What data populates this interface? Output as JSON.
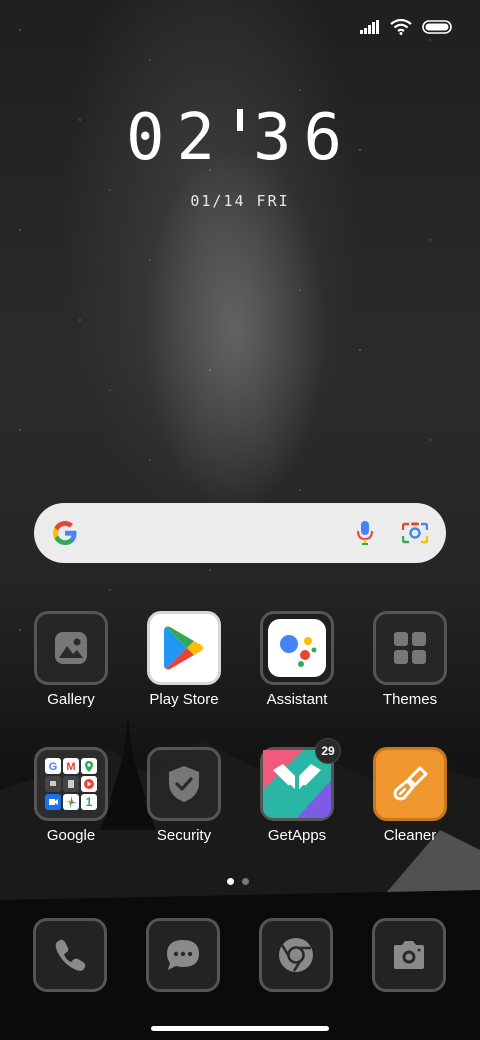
{
  "status_bar": {
    "signal_icon": "signal-bars-icon",
    "wifi_icon": "wifi-icon",
    "battery_icon": "battery-icon"
  },
  "clock": {
    "hours": "02",
    "minutes": "36"
  },
  "date": "01/14 FRI",
  "search_bar": {
    "logo_icon": "google-g-icon",
    "mic_icon": "microphone-icon",
    "lens_icon": "lens-camera-icon"
  },
  "apps": [
    {
      "label": "Gallery",
      "icon": "gallery-icon"
    },
    {
      "label": "Play Store",
      "icon": "play-store-icon"
    },
    {
      "label": "Assistant",
      "icon": "assistant-icon"
    },
    {
      "label": "Themes",
      "icon": "themes-icon"
    },
    {
      "label": "Google",
      "icon": "google-folder-icon"
    },
    {
      "label": "Security",
      "icon": "shield-check-icon"
    },
    {
      "label": "GetApps",
      "icon": "getapps-icon",
      "badge": "29"
    },
    {
      "label": "Cleaner",
      "icon": "broom-icon"
    }
  ],
  "page_indicator": {
    "pages": 2,
    "active": 1
  },
  "dock": [
    {
      "icon": "phone-icon"
    },
    {
      "icon": "messages-icon"
    },
    {
      "icon": "chrome-icon"
    },
    {
      "icon": "camera-icon"
    }
  ],
  "colors": {
    "google_blue": "#4285F4",
    "google_red": "#EA4335",
    "google_yellow": "#FBBC05",
    "google_green": "#34A853",
    "cleaner_orange": "#F0962E",
    "tile_border": "#555555"
  }
}
